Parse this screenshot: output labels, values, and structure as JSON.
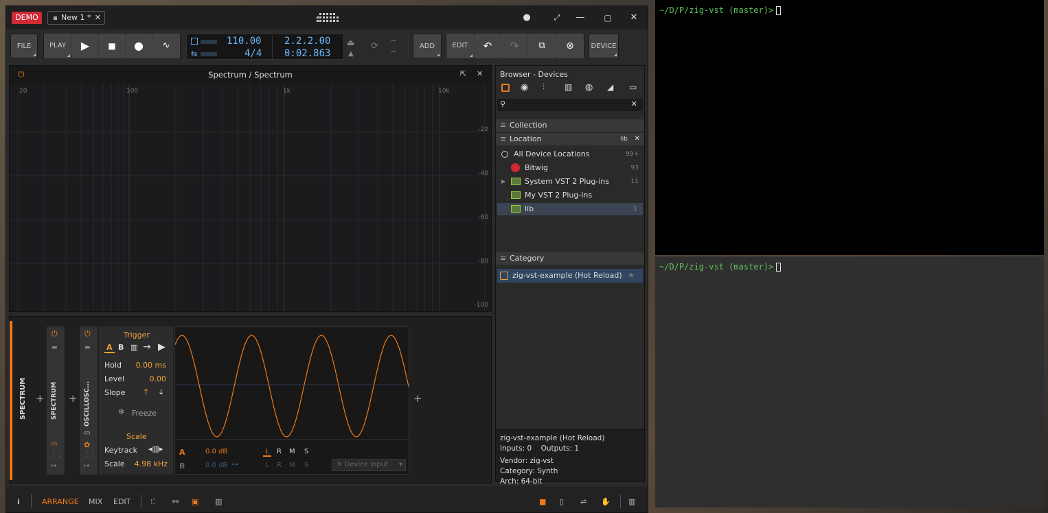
{
  "titlebar": {
    "demo": "DEMO",
    "tab": "New 1 *",
    "tab_close": "✕"
  },
  "transport": {
    "file": "FILE",
    "play_label": "PLAY",
    "add": "ADD",
    "edit": "EDIT",
    "device": "DEVICE",
    "tempo": "110.00",
    "signature": "4/4",
    "position": "2.2.2.00",
    "time": "0:02.863"
  },
  "spectrum": {
    "title": "Spectrum / Spectrum",
    "freq_labels": [
      "20",
      "100",
      "1k",
      "10k"
    ],
    "db_labels": [
      "-20",
      "-40",
      "-60",
      "-80",
      "-100"
    ]
  },
  "chain": {
    "device1": "SPECTRUM",
    "device2": "SPECTRUM",
    "device3": "OSCILLOSC...",
    "trigger_title": "Trigger",
    "trig_a": "A",
    "trig_b": "B",
    "hold_label": "Hold",
    "hold_value": "0.00 ms",
    "level_label": "Level",
    "level_value": "0.00",
    "slope_label": "Slope",
    "freeze": "Freeze",
    "scale_title": "Scale",
    "keytrack_label": "Keytrack",
    "scale_label": "Scale",
    "scale_value": "4.98 kHz",
    "ch_a": "A",
    "ch_a_val": "0.0 dB",
    "ch_b": "B",
    "ch_b_val": "0.0 dB",
    "lrms": [
      "L",
      "R",
      "M",
      "S"
    ],
    "device_input": "Device Input"
  },
  "browser": {
    "title": "Browser - Devices",
    "collection": "Collection",
    "location": "Location",
    "location_tag": "lib",
    "items": [
      {
        "label": "All Device Locations",
        "count": "99+"
      },
      {
        "label": "Bitwig",
        "count": "93"
      },
      {
        "label": "System VST 2 Plug-ins",
        "count": "11"
      },
      {
        "label": "My VST 2 Plug-ins",
        "count": ""
      },
      {
        "label": "lib",
        "count": "1"
      }
    ],
    "category": "Category",
    "result": "zig-vst-example (Hot Reload)",
    "info_title": "zig-vst-example (Hot Reload)",
    "info_io": "Inputs: 0    Outputs: 1",
    "info_vendor": "Vendor: zig-vst",
    "info_category": "Category: Synth",
    "info_arch": "Arch: 64-bit"
  },
  "bottombar": {
    "info": "i",
    "arrange": "ARRANGE",
    "mix": "MIX",
    "edit": "EDIT"
  },
  "terminal": {
    "path": "~/D/P/zig-vst",
    "branch": "(master)>"
  },
  "colors": {
    "accent": "#f07a1a",
    "display": "#6cb8ff",
    "prompt": "#5ec35e",
    "demo": "#d02a34"
  }
}
